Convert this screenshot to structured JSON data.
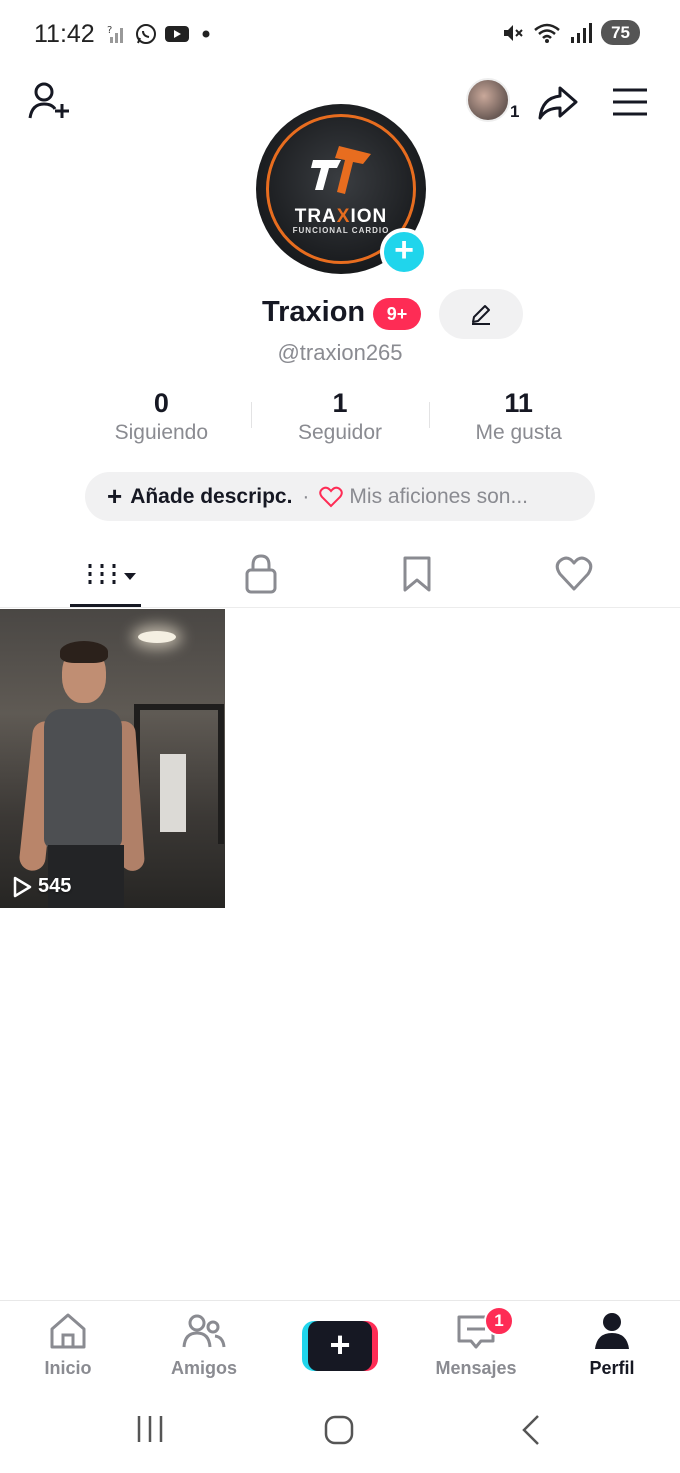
{
  "status_bar": {
    "time": "11:42",
    "battery": "75"
  },
  "top_bar": {
    "story_count": "1"
  },
  "profile": {
    "avatar_logo_word_a": "TRA",
    "avatar_logo_word_b": "X",
    "avatar_logo_word_c": "ION",
    "avatar_logo_sub": "FUNCIONAL CARDIO",
    "name": "Traxion",
    "notification_badge": "9+",
    "handle": "@traxion265"
  },
  "stats": [
    {
      "value": "0",
      "label": "Siguiendo"
    },
    {
      "value": "1",
      "label": "Seguidor"
    },
    {
      "value": "11",
      "label": "Me gusta"
    }
  ],
  "description": {
    "add_label": "Añade descripc.",
    "separator": "·",
    "hobbies_label": "Mis aficiones son..."
  },
  "videos": [
    {
      "views": "545"
    }
  ],
  "bottom_nav": {
    "home": "Inicio",
    "friends": "Amigos",
    "create": "+",
    "messages": "Mensajes",
    "messages_badge": "1",
    "profile": "Perfil"
  },
  "colors": {
    "accent_red": "#fe2c55",
    "accent_cyan": "#20d5ec",
    "brand_orange": "#e86d1f",
    "text_primary": "#161823",
    "text_secondary": "#8a8b91"
  }
}
